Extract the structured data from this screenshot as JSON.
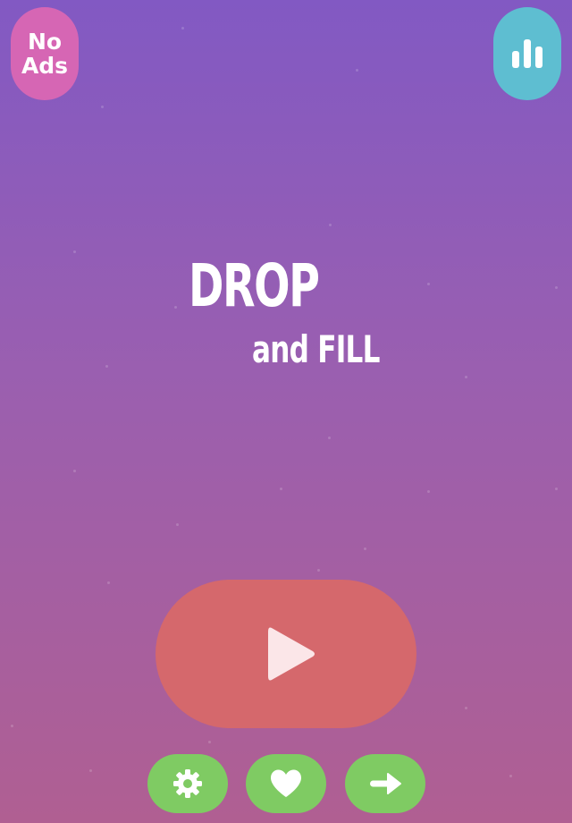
{
  "top_bar": {
    "no_ads": {
      "line1": "No",
      "line2": "Ads",
      "color": "#d666b4"
    },
    "leaderboard": {
      "icon": "bar-chart-icon",
      "color": "#5ebed1"
    }
  },
  "title": {
    "line1": "DROP",
    "line2": "and FILL"
  },
  "play_button": {
    "icon": "play-icon",
    "color": "#d5686c"
  },
  "bottom_bar": {
    "buttons": [
      {
        "name": "settings",
        "icon": "gear-icon"
      },
      {
        "name": "like",
        "icon": "heart-icon"
      },
      {
        "name": "share",
        "icon": "arrow-right-icon"
      }
    ],
    "color": "#7fcb63"
  },
  "background": {
    "top_color": "#8259c3",
    "bottom_color": "#b05f92"
  }
}
